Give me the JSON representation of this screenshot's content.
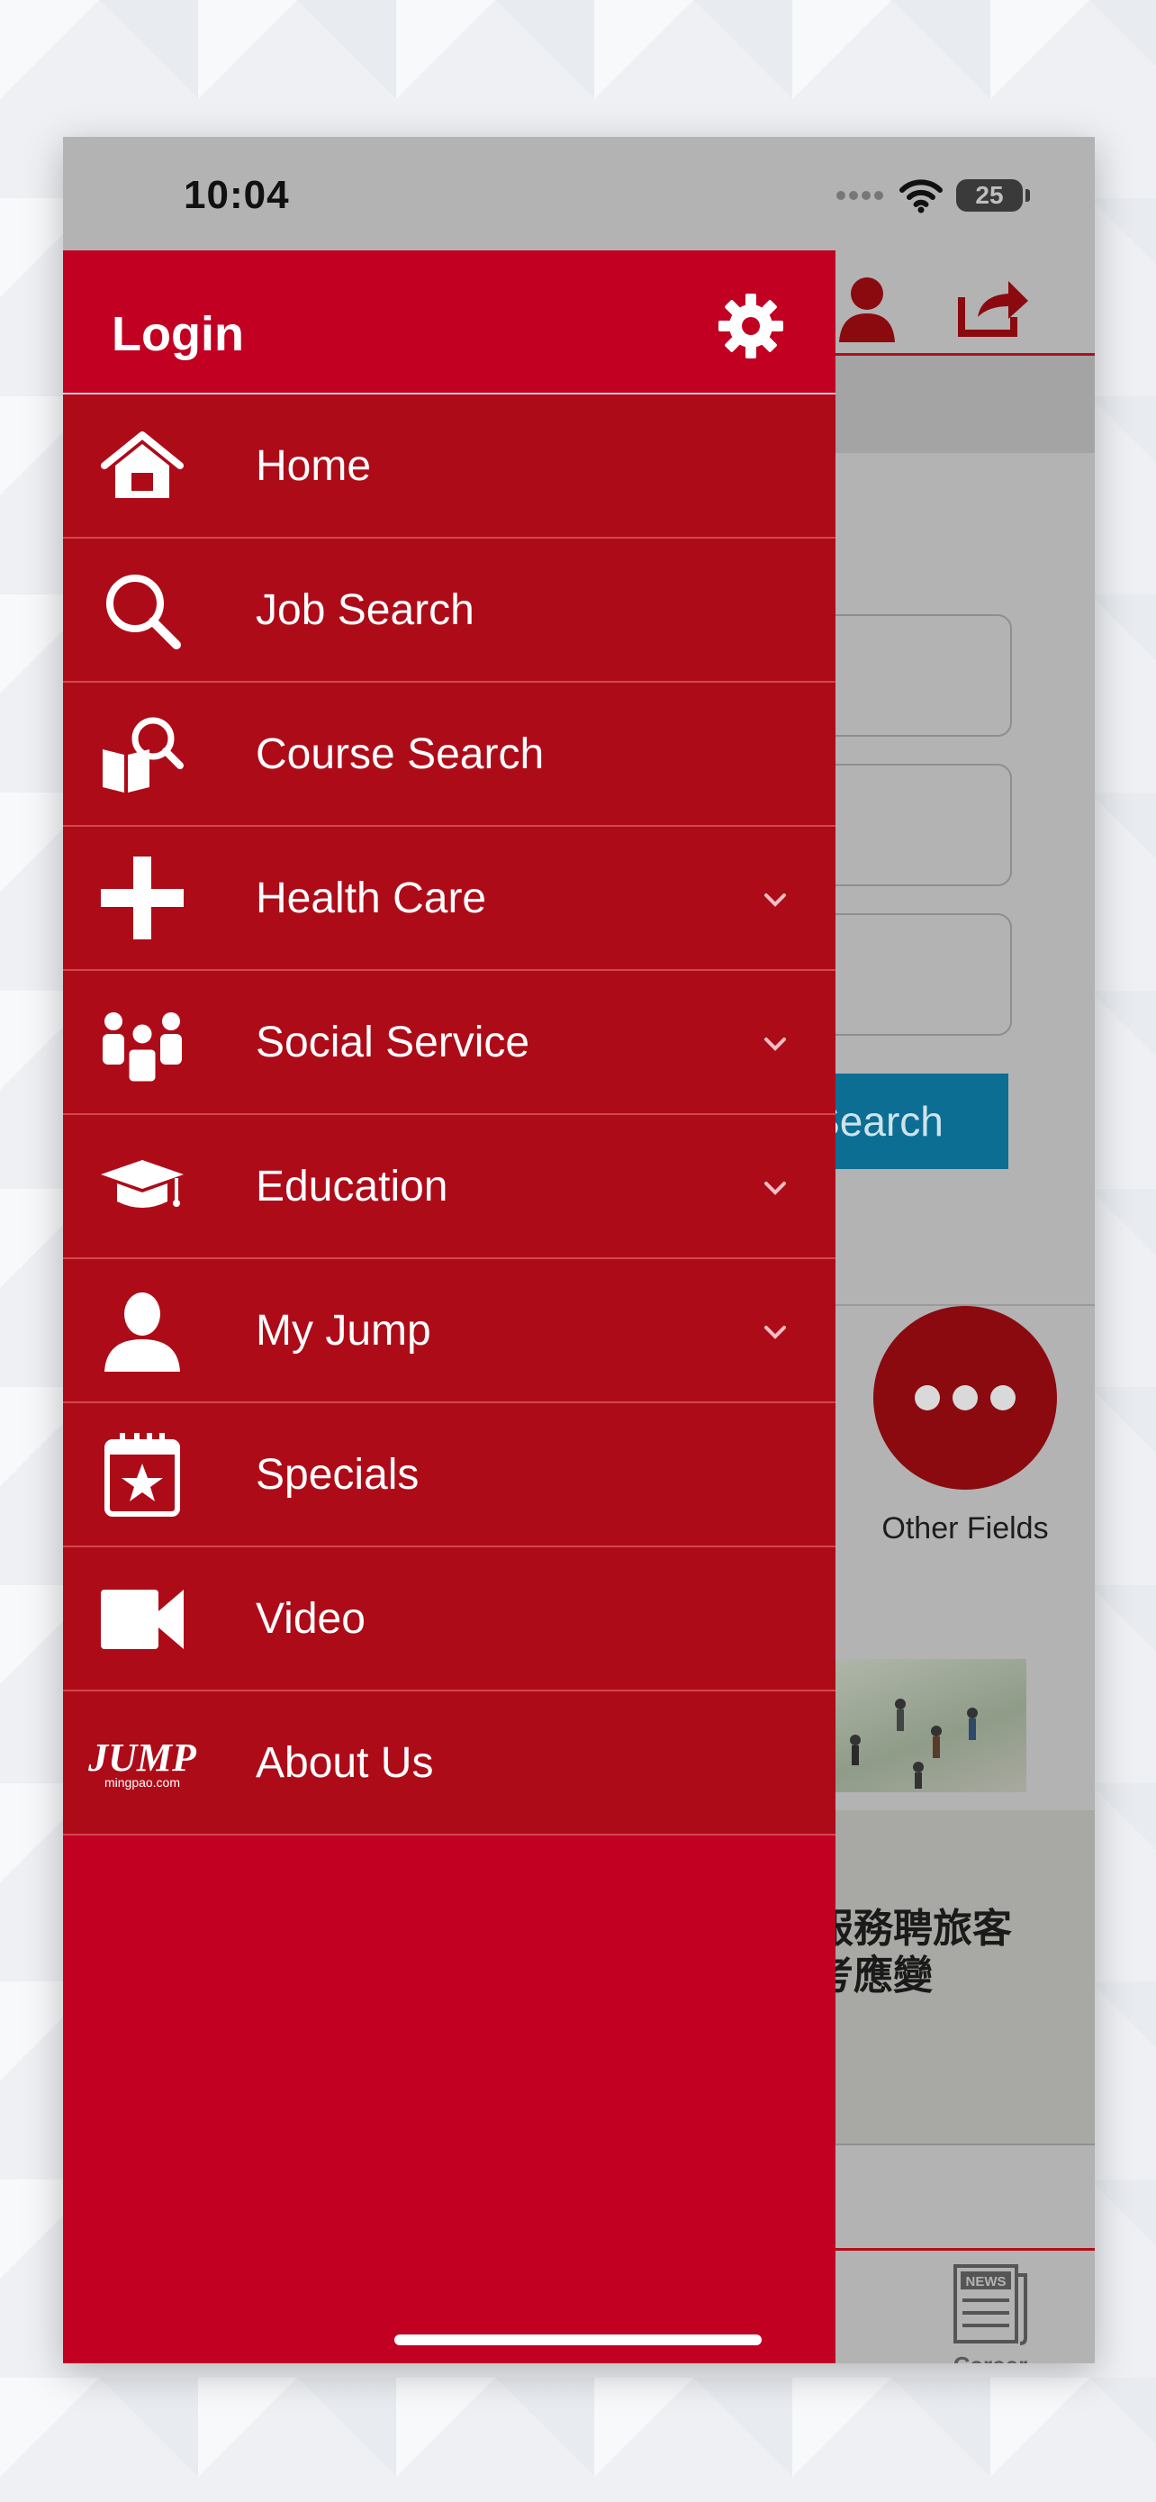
{
  "status_bar": {
    "time": "10:04",
    "battery": "25"
  },
  "drawer": {
    "login_label": "Login",
    "items": [
      {
        "label": "Home",
        "icon": "home-icon",
        "expandable": false
      },
      {
        "label": "Job Search",
        "icon": "search-icon",
        "expandable": false
      },
      {
        "label": "Course Search",
        "icon": "book-search-icon",
        "expandable": false
      },
      {
        "label": "Health Care",
        "icon": "plus-cross-icon",
        "expandable": true
      },
      {
        "label": "Social Service",
        "icon": "people-group-icon",
        "expandable": true
      },
      {
        "label": "Education",
        "icon": "graduation-cap-icon",
        "expandable": true
      },
      {
        "label": "My Jump",
        "icon": "user-icon",
        "expandable": true
      },
      {
        "label": "Specials",
        "icon": "calendar-star-icon",
        "expandable": false
      },
      {
        "label": "Video",
        "icon": "video-camera-icon",
        "expandable": false
      },
      {
        "label": "About Us",
        "icon": "jump-logo-icon",
        "expandable": false
      }
    ],
    "logo_text": "JUMP",
    "logo_subtext": "mingpao.com"
  },
  "background": {
    "search_button": "Search",
    "other_fields_label": "Other Fields",
    "article_headline": "动服務聘旅客\n刂考應變",
    "career_news_label": "Career\nNews",
    "career_news_badge": "NEWS"
  },
  "colors": {
    "drawer_red": "#c10022",
    "item_red": "#ae0b18",
    "accent_blue": "#0d6e93"
  }
}
